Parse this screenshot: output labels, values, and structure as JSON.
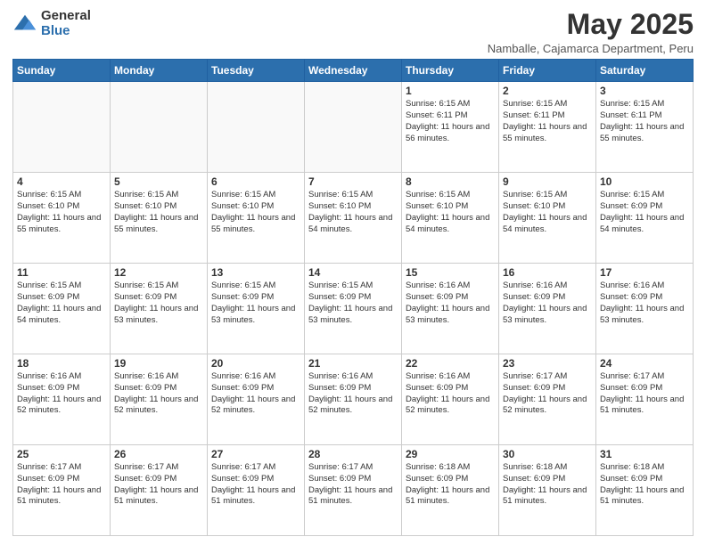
{
  "logo": {
    "general": "General",
    "blue": "Blue"
  },
  "header": {
    "month": "May 2025",
    "location": "Namballe, Cajamarca Department, Peru"
  },
  "weekdays": [
    "Sunday",
    "Monday",
    "Tuesday",
    "Wednesday",
    "Thursday",
    "Friday",
    "Saturday"
  ],
  "weeks": [
    [
      {
        "day": "",
        "info": ""
      },
      {
        "day": "",
        "info": ""
      },
      {
        "day": "",
        "info": ""
      },
      {
        "day": "",
        "info": ""
      },
      {
        "day": "1",
        "info": "Sunrise: 6:15 AM\nSunset: 6:11 PM\nDaylight: 11 hours\nand 56 minutes."
      },
      {
        "day": "2",
        "info": "Sunrise: 6:15 AM\nSunset: 6:11 PM\nDaylight: 11 hours\nand 55 minutes."
      },
      {
        "day": "3",
        "info": "Sunrise: 6:15 AM\nSunset: 6:11 PM\nDaylight: 11 hours\nand 55 minutes."
      }
    ],
    [
      {
        "day": "4",
        "info": "Sunrise: 6:15 AM\nSunset: 6:10 PM\nDaylight: 11 hours\nand 55 minutes."
      },
      {
        "day": "5",
        "info": "Sunrise: 6:15 AM\nSunset: 6:10 PM\nDaylight: 11 hours\nand 55 minutes."
      },
      {
        "day": "6",
        "info": "Sunrise: 6:15 AM\nSunset: 6:10 PM\nDaylight: 11 hours\nand 55 minutes."
      },
      {
        "day": "7",
        "info": "Sunrise: 6:15 AM\nSunset: 6:10 PM\nDaylight: 11 hours\nand 54 minutes."
      },
      {
        "day": "8",
        "info": "Sunrise: 6:15 AM\nSunset: 6:10 PM\nDaylight: 11 hours\nand 54 minutes."
      },
      {
        "day": "9",
        "info": "Sunrise: 6:15 AM\nSunset: 6:10 PM\nDaylight: 11 hours\nand 54 minutes."
      },
      {
        "day": "10",
        "info": "Sunrise: 6:15 AM\nSunset: 6:09 PM\nDaylight: 11 hours\nand 54 minutes."
      }
    ],
    [
      {
        "day": "11",
        "info": "Sunrise: 6:15 AM\nSunset: 6:09 PM\nDaylight: 11 hours\nand 54 minutes."
      },
      {
        "day": "12",
        "info": "Sunrise: 6:15 AM\nSunset: 6:09 PM\nDaylight: 11 hours\nand 53 minutes."
      },
      {
        "day": "13",
        "info": "Sunrise: 6:15 AM\nSunset: 6:09 PM\nDaylight: 11 hours\nand 53 minutes."
      },
      {
        "day": "14",
        "info": "Sunrise: 6:15 AM\nSunset: 6:09 PM\nDaylight: 11 hours\nand 53 minutes."
      },
      {
        "day": "15",
        "info": "Sunrise: 6:16 AM\nSunset: 6:09 PM\nDaylight: 11 hours\nand 53 minutes."
      },
      {
        "day": "16",
        "info": "Sunrise: 6:16 AM\nSunset: 6:09 PM\nDaylight: 11 hours\nand 53 minutes."
      },
      {
        "day": "17",
        "info": "Sunrise: 6:16 AM\nSunset: 6:09 PM\nDaylight: 11 hours\nand 53 minutes."
      }
    ],
    [
      {
        "day": "18",
        "info": "Sunrise: 6:16 AM\nSunset: 6:09 PM\nDaylight: 11 hours\nand 52 minutes."
      },
      {
        "day": "19",
        "info": "Sunrise: 6:16 AM\nSunset: 6:09 PM\nDaylight: 11 hours\nand 52 minutes."
      },
      {
        "day": "20",
        "info": "Sunrise: 6:16 AM\nSunset: 6:09 PM\nDaylight: 11 hours\nand 52 minutes."
      },
      {
        "day": "21",
        "info": "Sunrise: 6:16 AM\nSunset: 6:09 PM\nDaylight: 11 hours\nand 52 minutes."
      },
      {
        "day": "22",
        "info": "Sunrise: 6:16 AM\nSunset: 6:09 PM\nDaylight: 11 hours\nand 52 minutes."
      },
      {
        "day": "23",
        "info": "Sunrise: 6:17 AM\nSunset: 6:09 PM\nDaylight: 11 hours\nand 52 minutes."
      },
      {
        "day": "24",
        "info": "Sunrise: 6:17 AM\nSunset: 6:09 PM\nDaylight: 11 hours\nand 51 minutes."
      }
    ],
    [
      {
        "day": "25",
        "info": "Sunrise: 6:17 AM\nSunset: 6:09 PM\nDaylight: 11 hours\nand 51 minutes."
      },
      {
        "day": "26",
        "info": "Sunrise: 6:17 AM\nSunset: 6:09 PM\nDaylight: 11 hours\nand 51 minutes."
      },
      {
        "day": "27",
        "info": "Sunrise: 6:17 AM\nSunset: 6:09 PM\nDaylight: 11 hours\nand 51 minutes."
      },
      {
        "day": "28",
        "info": "Sunrise: 6:17 AM\nSunset: 6:09 PM\nDaylight: 11 hours\nand 51 minutes."
      },
      {
        "day": "29",
        "info": "Sunrise: 6:18 AM\nSunset: 6:09 PM\nDaylight: 11 hours\nand 51 minutes."
      },
      {
        "day": "30",
        "info": "Sunrise: 6:18 AM\nSunset: 6:09 PM\nDaylight: 11 hours\nand 51 minutes."
      },
      {
        "day": "31",
        "info": "Sunrise: 6:18 AM\nSunset: 6:09 PM\nDaylight: 11 hours\nand 51 minutes."
      }
    ]
  ]
}
